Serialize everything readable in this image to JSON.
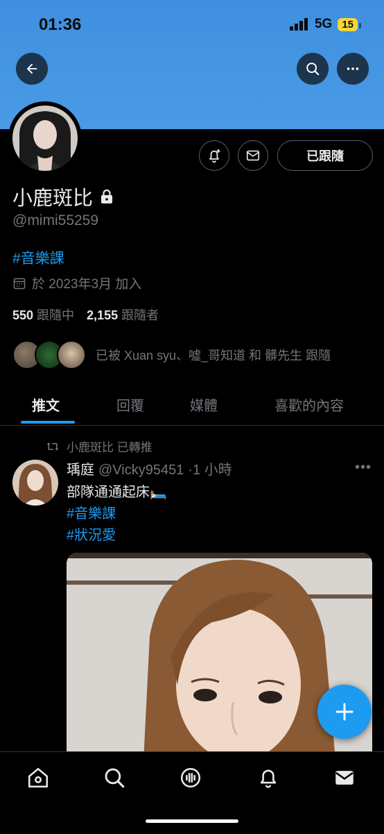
{
  "status_bar": {
    "time": "01:36",
    "network": "5G",
    "battery": "15"
  },
  "header": {
    "back_icon": "arrow-left-icon",
    "search_icon": "search-icon",
    "more_icon": "more-icon"
  },
  "profile": {
    "display_name": "小鹿斑比",
    "locked": true,
    "handle": "@mimi55259",
    "bio_hashtag": "#音樂課",
    "joined": "於 2023年3月 加入",
    "following_count": "550",
    "following_label": "跟隨中",
    "followers_count": "2,155",
    "followers_label": "跟隨者",
    "follow_button": "已跟隨",
    "followed_by_text": "已被 Xuan syu、噓_哥知道 和 髒先生 跟隨"
  },
  "tabs": [
    {
      "label": "推文",
      "active": true
    },
    {
      "label": "回覆",
      "active": false
    },
    {
      "label": "媒體",
      "active": false
    },
    {
      "label": "喜歡的內容",
      "active": false
    }
  ],
  "post": {
    "retweet_label": "小鹿斑比 已轉推",
    "author_name": "瑀庭",
    "author_handle": "@Vicky95451",
    "time": "·1 小時",
    "text": "部隊通通起床🛏️",
    "hashtags": [
      "#音樂課",
      "#狀況愛"
    ]
  },
  "colors": {
    "accent": "#1d9bf0",
    "banner": "#4a9be6",
    "background": "#000000"
  }
}
